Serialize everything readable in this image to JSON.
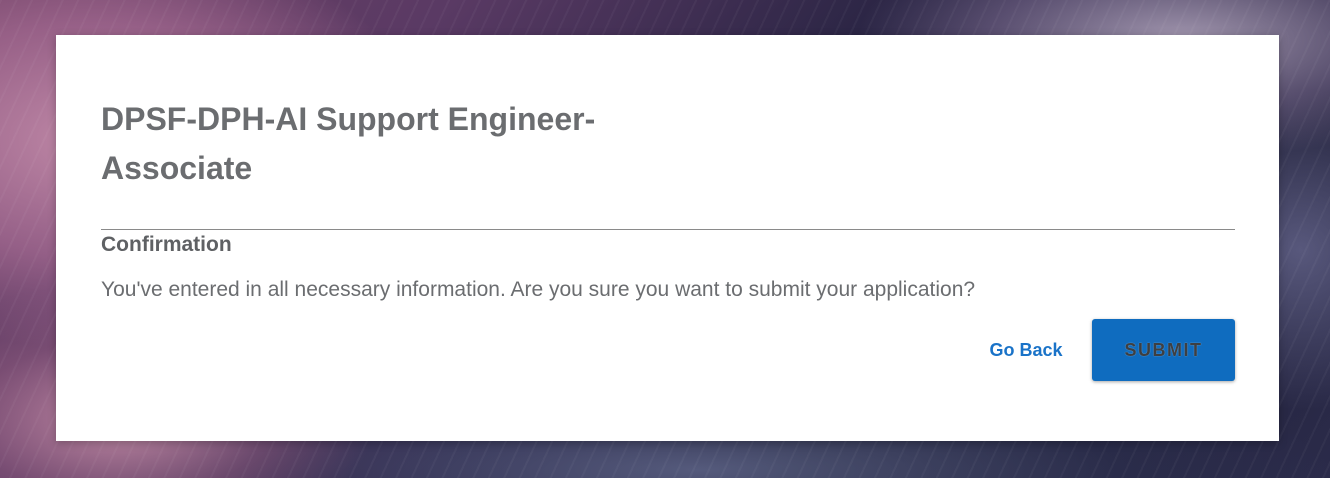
{
  "dialog": {
    "job_title": "DPSF-DPH-AI Support Engineer-Associate",
    "section_heading": "Confirmation",
    "message": "You've entered in all necessary information. Are you sure you want to submit your application?",
    "go_back_label": "Go Back",
    "submit_label": "SUBMIT"
  },
  "colors": {
    "accent": "#0f6cbf",
    "link": "#1a73c8",
    "title_text": "#6b6d70",
    "dialog_background": "#ffffff"
  }
}
